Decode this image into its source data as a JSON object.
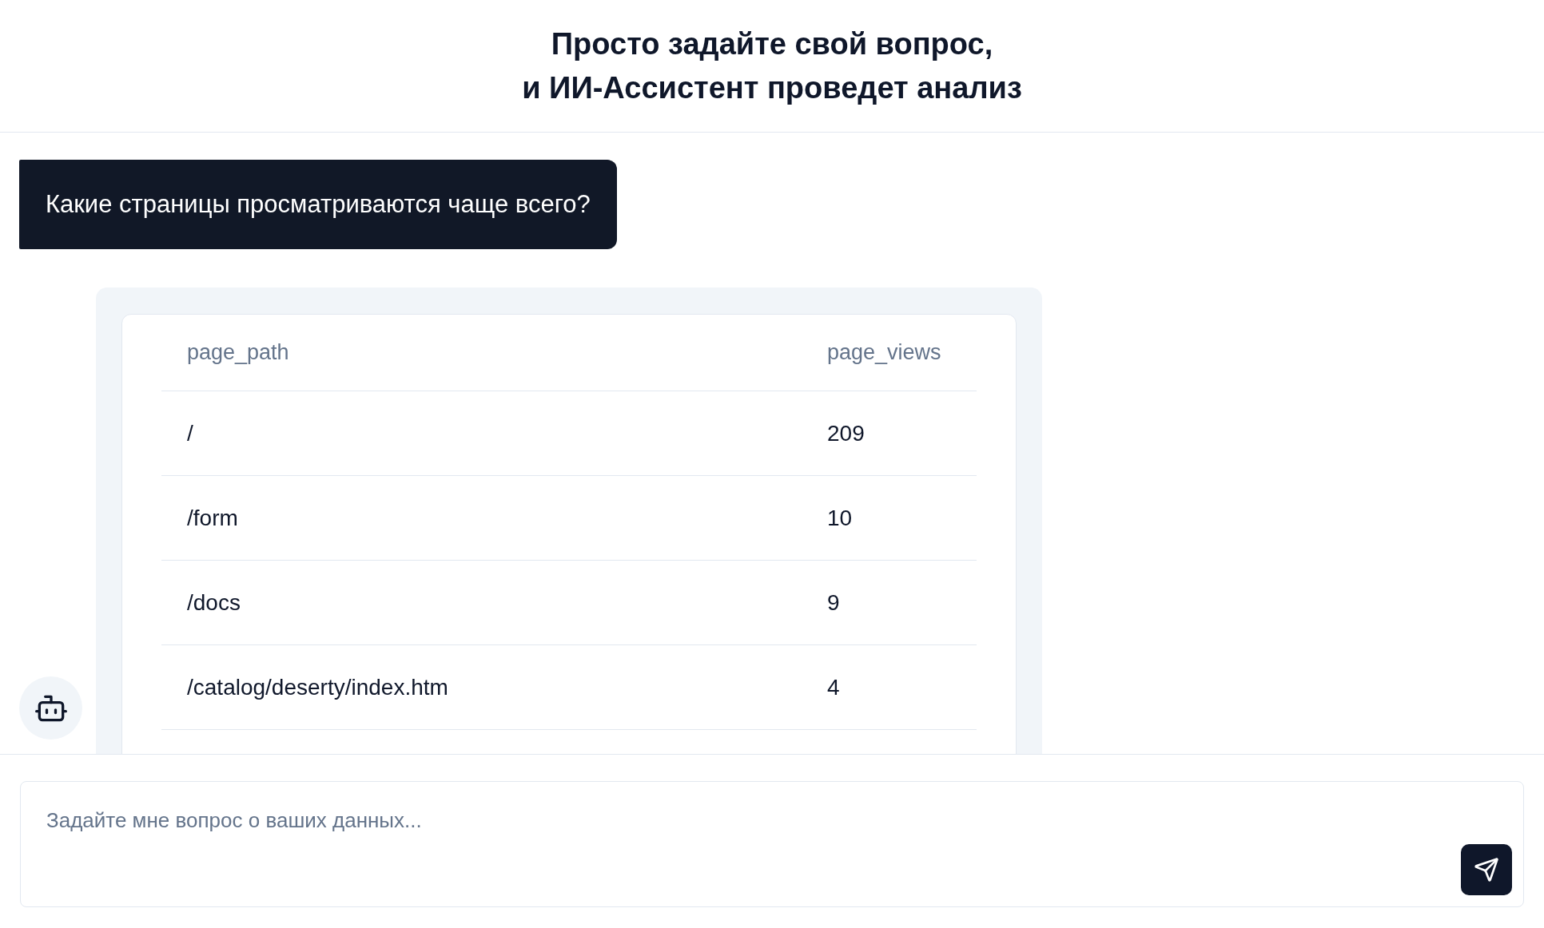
{
  "header": {
    "title_lines": [
      "Просто задайте свой вопрос,",
      "и ИИ-Ассистент проведет анализ"
    ]
  },
  "messages": [
    {
      "kind": "user",
      "text": "Какие страницы просматриваются чаще всего?"
    },
    {
      "kind": "assistant_table",
      "table": {
        "columns": [
          "page_path",
          "page_views"
        ],
        "rows": [
          [
            "/",
            "209"
          ],
          [
            "/form",
            "10"
          ],
          [
            "/docs",
            "9"
          ],
          [
            "/catalog/deserty/index.htm",
            "4"
          ]
        ]
      }
    }
  ],
  "composer": {
    "placeholder": "Задайте мне вопрос о ваших данных..."
  }
}
